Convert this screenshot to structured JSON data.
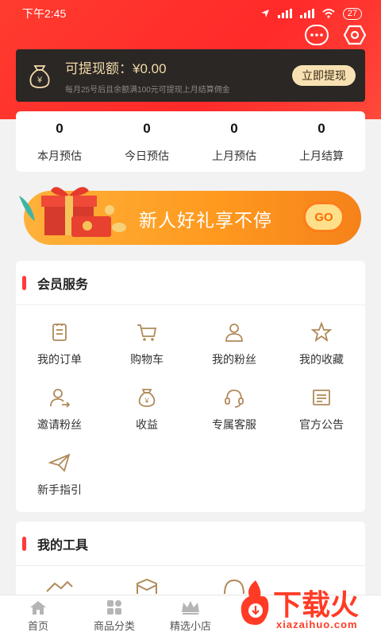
{
  "status_bar": {
    "time": "下午2:45",
    "battery": "27"
  },
  "withdraw": {
    "title": "可提现额：¥0.00",
    "subtitle": "每月25号后且余额满100元可提现上月结算佣金",
    "button": "立即提现"
  },
  "stats": [
    {
      "value": "0",
      "label": "本月预估"
    },
    {
      "value": "0",
      "label": "今日预估"
    },
    {
      "value": "0",
      "label": "上月预估"
    },
    {
      "value": "0",
      "label": "上月结算"
    }
  ],
  "banner": {
    "text": "新人好礼享不停",
    "go": "GO"
  },
  "member_services": {
    "title": "会员服务",
    "items": [
      {
        "label": "我的订单",
        "icon": "order-icon"
      },
      {
        "label": "购物车",
        "icon": "cart-icon"
      },
      {
        "label": "我的粉丝",
        "icon": "user-icon"
      },
      {
        "label": "我的收藏",
        "icon": "star-icon"
      },
      {
        "label": "邀请粉丝",
        "icon": "invite-icon"
      },
      {
        "label": "收益",
        "icon": "money-bag-icon"
      },
      {
        "label": "专属客服",
        "icon": "headset-icon"
      },
      {
        "label": "官方公告",
        "icon": "notice-icon"
      },
      {
        "label": "新手指引",
        "icon": "paper-plane-icon"
      }
    ]
  },
  "my_tools": {
    "title": "我的工具"
  },
  "tabbar": [
    {
      "label": "首页",
      "icon": "home-icon"
    },
    {
      "label": "商品分类",
      "icon": "category-icon"
    },
    {
      "label": "精选小店",
      "icon": "crown-icon"
    }
  ],
  "watermark": {
    "text": "下载火",
    "url": "xiazaihuo.com"
  },
  "colors": {
    "brand_red": "#ff3b2f",
    "gold": "#b08a5a",
    "card_dark": "#2a2725"
  }
}
